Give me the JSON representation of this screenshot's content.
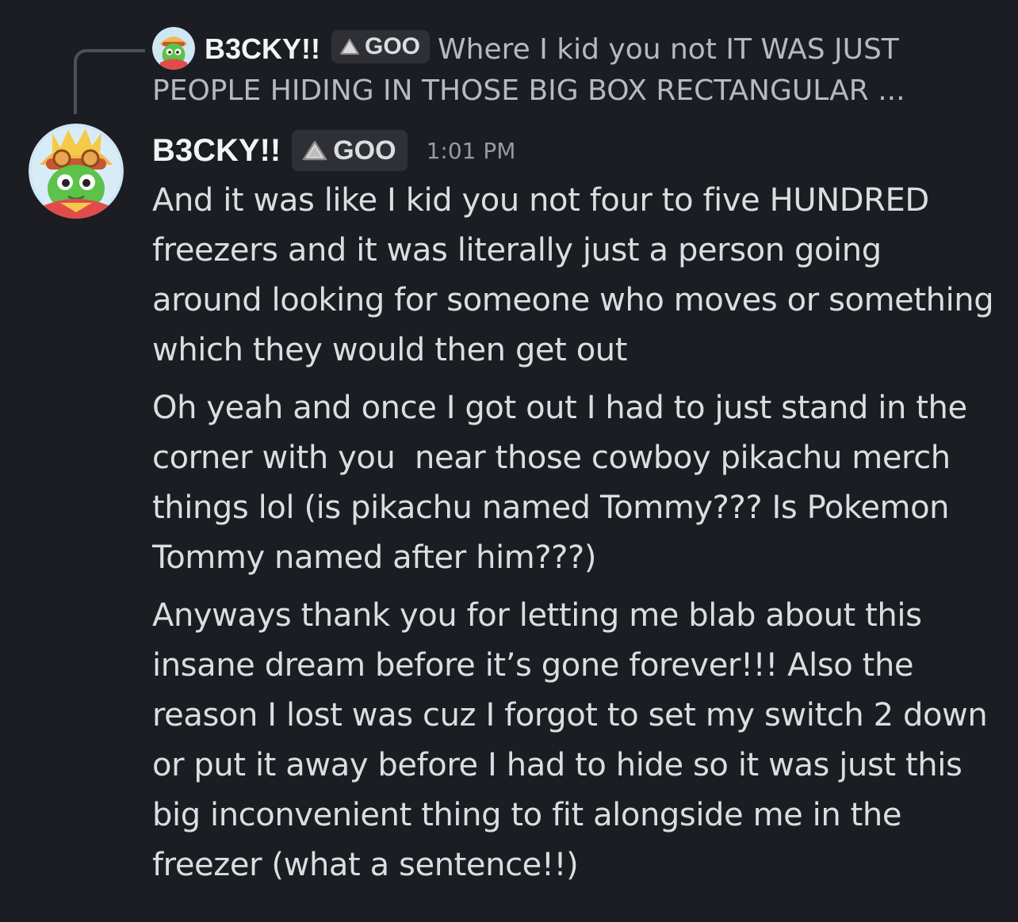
{
  "reply": {
    "author": "B3CKY!!",
    "tag": "GOO",
    "preview_text": "Where I kid you not IT WAS JUST PEOPLE HIDING IN THOSE BIG BOX RECTANGULAR ..."
  },
  "message": {
    "author": "B3CKY!!",
    "tag": "GOO",
    "timestamp": "1:01 PM",
    "paragraphs": [
      "And it was like I kid you not four to five HUNDRED freezers and it was literally just a person going around looking for someone who moves or something which they would then get out",
      "Oh yeah and once I got out I had to just stand in the corner with you  near those cowboy pikachu merch things lol (is pikachu named Tommy??? Is Pokemon Tommy named after him???)",
      "Anyways thank you for letting me blab about this insane dream before it’s gone forever!!! Also the reason I lost was cuz I forgot to set my switch 2 down or put it away before I had to hide so it was just this big inconvenient thing to fit alongside me in the freezer (what a sentence!!)"
    ]
  },
  "icons": {
    "tag_icon": "goo-blob-icon",
    "avatar": "green-dinosaur-cowboy-avatar"
  },
  "colors": {
    "background": "#1c1d22",
    "text": "#dbdee1",
    "muted": "#b5bac1",
    "timestamp": "#949ba4",
    "tag_bg": "#2e3036"
  }
}
